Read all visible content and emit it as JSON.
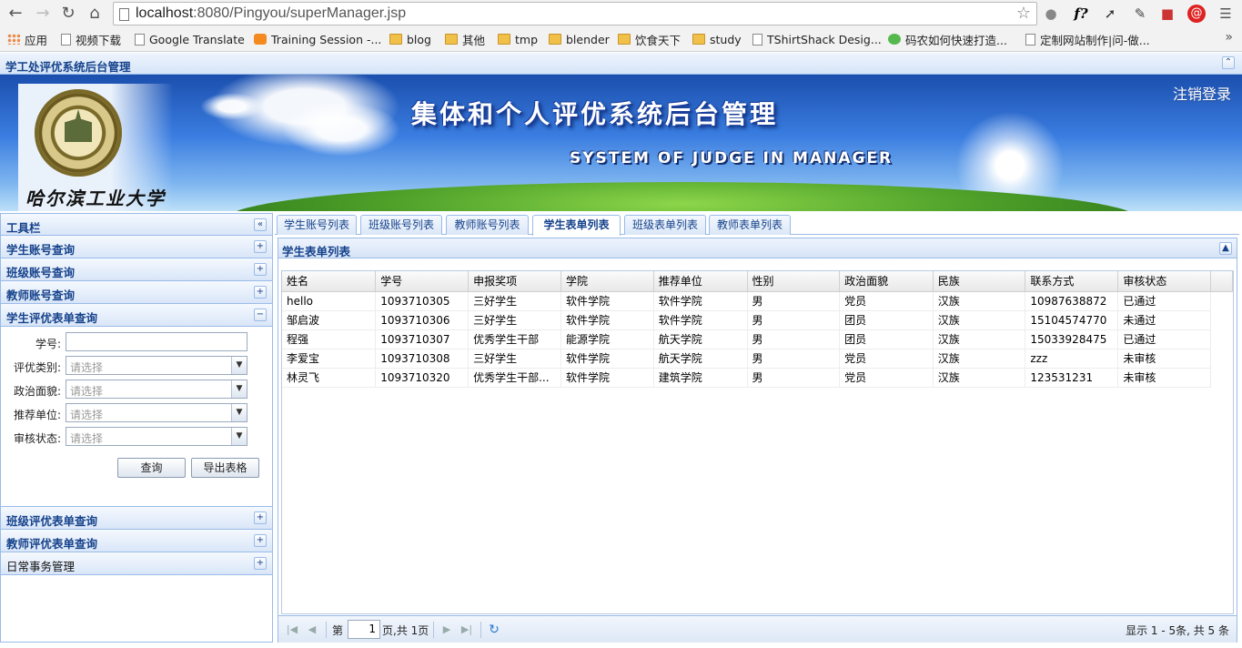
{
  "browser": {
    "url_host": "localhost",
    "url_path": ":8080/Pingyou/superManager.jsp",
    "bookmarks": [
      "应用",
      "视频下载",
      "Google Translate",
      "Training Session -...",
      "blog",
      "其他",
      "tmp",
      "blender",
      "饮食天下",
      "study",
      "TShirtShack Desig...",
      "码农如何快速打造...",
      "定制网站制作|问-做..."
    ]
  },
  "app": {
    "title": "学工处评优系统后台管理",
    "banner_title": "集体和个人评优系统后台管理",
    "banner_subtitle": "SYSTEM OF JUDGE IN MANAGER",
    "school_name": "哈尔滨工业大学",
    "logout": "注销登录"
  },
  "sidebar": {
    "title": "工具栏",
    "sections_top": [
      "学生账号查询",
      "班级账号查询",
      "教师账号查询"
    ],
    "active_section": "学生评优表单查询",
    "form": {
      "labels": [
        "学号:",
        "评优类别:",
        "政治面貌:",
        "推荐单位:",
        "审核状态:"
      ],
      "placeholder": "请选择",
      "query_button": "查询",
      "export_button": "导出表格"
    },
    "sections_bottom": [
      "班级评优表单查询",
      "教师评优表单查询"
    ],
    "last_section": "日常事务管理"
  },
  "tabs": [
    "学生账号列表",
    "班级账号列表",
    "教师账号列表",
    "学生表单列表",
    "班级表单列表",
    "教师表单列表"
  ],
  "grid": {
    "title": "学生表单列表",
    "columns": [
      "姓名",
      "学号",
      "申报奖项",
      "学院",
      "推荐单位",
      "性别",
      "政治面貌",
      "民族",
      "联系方式",
      "审核状态"
    ],
    "rows": [
      [
        "hello",
        "1093710305",
        "三好学生",
        "软件学院",
        "软件学院",
        "男",
        "党员",
        "汉族",
        "10987638872",
        "已通过"
      ],
      [
        "邹启波",
        "1093710306",
        "三好学生",
        "软件学院",
        "软件学院",
        "男",
        "团员",
        "汉族",
        "15104574770",
        "未通过"
      ],
      [
        "程强",
        "1093710307",
        "优秀学生干部",
        "能源学院",
        "航天学院",
        "男",
        "团员",
        "汉族",
        "15033928475",
        "已通过"
      ],
      [
        "李爱宝",
        "1093710308",
        "三好学生",
        "软件学院",
        "航天学院",
        "男",
        "党员",
        "汉族",
        "zzz",
        "未审核"
      ],
      [
        "林灵飞",
        "1093710320",
        "优秀学生干部...",
        "软件学院",
        "建筑学院",
        "男",
        "党员",
        "汉族",
        "123531231",
        "未审核"
      ]
    ]
  },
  "pager": {
    "page_prefix": "第",
    "page_value": "1",
    "page_suffix": "页,共 1页",
    "summary": "显示 1 - 5条, 共 5 条"
  }
}
